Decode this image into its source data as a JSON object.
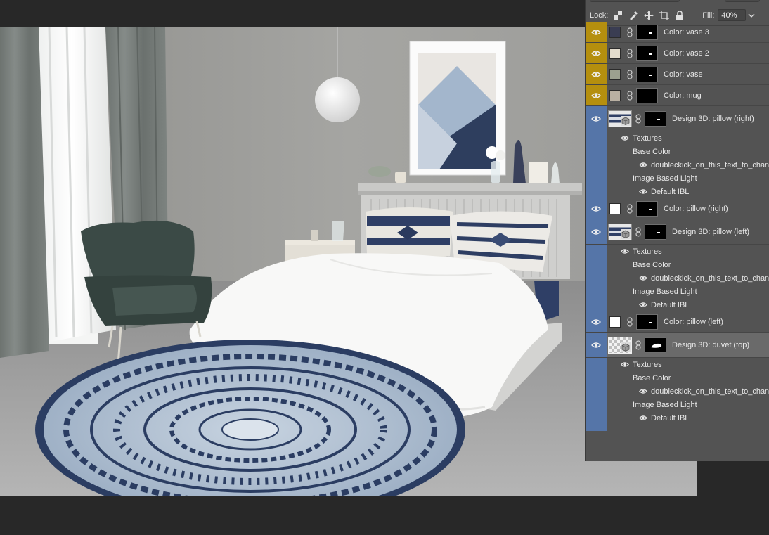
{
  "lock_bar": {
    "lock_label": "Lock:",
    "fill_label": "Fill:",
    "fill_value": "40%"
  },
  "layers": [
    {
      "type": "color",
      "name": "Color: vase 3",
      "swatch": "#3a3d52",
      "eye_color": "#b58f0e"
    },
    {
      "type": "color",
      "name": "Color: vase 2",
      "swatch": "#e3dccd",
      "eye_color": "#b58f0e"
    },
    {
      "type": "color",
      "name": "Color: vase",
      "swatch": "#9ca08f",
      "eye_color": "#b58f0e"
    },
    {
      "type": "color",
      "name": "Color: mug",
      "swatch": "#b9b0a2",
      "eye_color": "#b58f0e"
    },
    {
      "type": "design3d",
      "name": "Design 3D: pillow (right)",
      "eye_color": "#5575a8",
      "textures_label": "Textures",
      "base_color_label": "Base Color",
      "base_color_file": "doubleckick_on_this_text_to_chan",
      "ibl_label": "Image Based Light",
      "ibl_value": "Default IBL"
    },
    {
      "type": "color",
      "name": "Color: pillow (right)",
      "swatch": "#ffffff",
      "eye_color": "#5575a8"
    },
    {
      "type": "design3d",
      "name": "Design 3D: pillow (left)",
      "eye_color": "#5575a8",
      "textures_label": "Textures",
      "base_color_label": "Base Color",
      "base_color_file": "doubleckick_on_this_text_to_chan",
      "ibl_label": "Image Based Light",
      "ibl_value": "Default IBL"
    },
    {
      "type": "color",
      "name": "Color: pillow (left)",
      "swatch": "#ffffff",
      "eye_color": "#5575a8"
    },
    {
      "type": "design3d",
      "name": "Design 3D: duvet (top)",
      "eye_color": "#5575a8",
      "selected": true,
      "textures_label": "Textures",
      "base_color_label": "Base Color",
      "base_color_file": "doubleckick_on_this_text_to_chan",
      "ibl_label": "Image Based Light",
      "ibl_value": "Default IBL"
    }
  ]
}
